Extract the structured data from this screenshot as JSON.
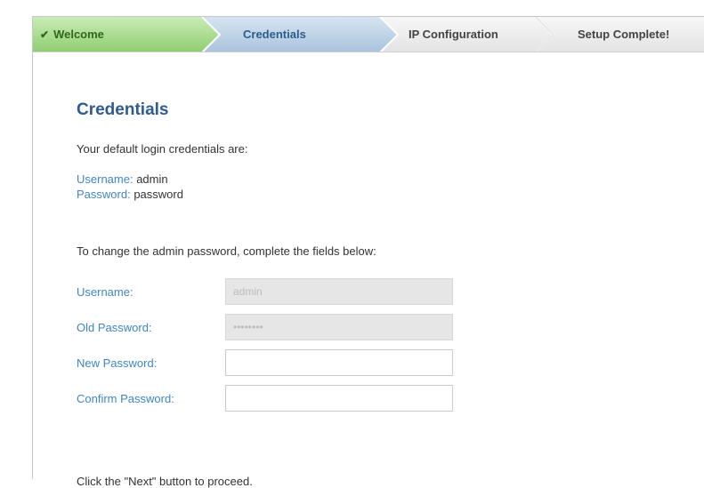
{
  "wizard": {
    "steps": [
      {
        "label": "Welcome",
        "state": "completed",
        "icon": "check-icon"
      },
      {
        "label": "Credentials",
        "state": "active"
      },
      {
        "label": "IP Configuration",
        "state": "pending"
      },
      {
        "label": "Setup Complete!",
        "state": "pending"
      }
    ],
    "colors": {
      "completed": "#a6d88a",
      "active": "#b9cfe3",
      "pending": "#eeeeee"
    }
  },
  "page": {
    "title": "Credentials",
    "intro": "Your default login credentials are:",
    "default_username_key": "Username:",
    "default_username_value": "admin",
    "default_password_key": "Password:",
    "default_password_value": "password",
    "change_instructions": "To change the admin password, complete the fields below:",
    "footer": "Click the \"Next\" button to proceed."
  },
  "form": {
    "username_label": "Username:",
    "username_value": "admin",
    "old_password_label": "Old Password:",
    "old_password_value": "••••••••",
    "new_password_label": "New Password:",
    "new_password_value": "",
    "confirm_password_label": "Confirm Password:",
    "confirm_password_value": ""
  },
  "theme": {
    "heading_color": "#2f5b91",
    "label_color": "#3f86c6"
  }
}
